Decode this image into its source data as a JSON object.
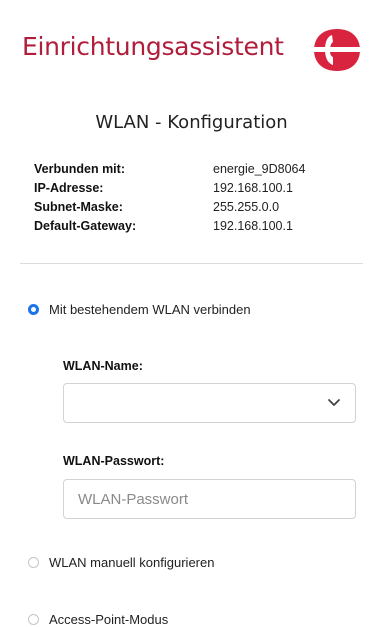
{
  "app_title": "Einrichtungsassistent",
  "brand_color": "#b01e3c",
  "accent_color": "#1a73e8",
  "section_title": "WLAN - Konfiguration",
  "connection_info": [
    {
      "key": "Verbunden mit:",
      "value": "energie_9D8064"
    },
    {
      "key": "IP-Adresse:",
      "value": "192.168.100.1"
    },
    {
      "key": "Subnet-Maske:",
      "value": "255.255.0.0"
    },
    {
      "key": "Default-Gateway:",
      "value": "192.168.100.1"
    }
  ],
  "modes": [
    {
      "label": "Mit bestehendem WLAN verbinden",
      "selected": true
    },
    {
      "label": "WLAN manuell konfigurieren",
      "selected": false
    },
    {
      "label": "Access-Point-Modus",
      "selected": false
    }
  ],
  "wlan_name": {
    "label": "WLAN-Name:",
    "value": "",
    "icon": "chevron-down-icon"
  },
  "wlan_password": {
    "label": "WLAN-Passwort:",
    "value": "",
    "placeholder": "WLAN-Passwort"
  }
}
